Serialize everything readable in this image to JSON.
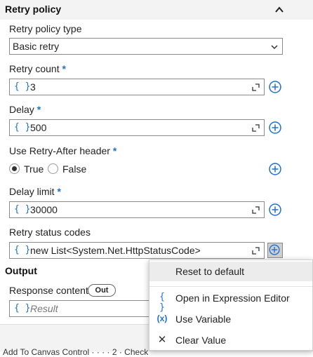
{
  "header": {
    "title": "Retry policy"
  },
  "retry_policy_type": {
    "label": "Retry policy type",
    "value": "Basic retry"
  },
  "retry_count": {
    "label": "Retry count",
    "required": "*",
    "value": "3"
  },
  "delay": {
    "label": "Delay",
    "required": "*",
    "value": "500"
  },
  "retry_after": {
    "label": "Use Retry-After header",
    "required": "*",
    "true_label": "True",
    "false_label": "False",
    "selected": "True"
  },
  "delay_limit": {
    "label": "Delay limit",
    "required": "*",
    "value": "30000"
  },
  "retry_status_codes": {
    "label": "Retry status codes",
    "value": "new List<System.Net.HttpStatusCode>"
  },
  "output": {
    "title": "Output",
    "response_content": {
      "label": "Response content",
      "badge": "Out",
      "placeholder": "Result"
    }
  },
  "footer": {
    "text": "Add To Canvas Control · · · · 2 · Check"
  },
  "context_menu": {
    "items": [
      {
        "label": "Reset to default",
        "icon": ""
      },
      {
        "label": "Open in Expression Editor",
        "icon": "{ }"
      },
      {
        "label": "Use Variable",
        "icon": "(x)"
      },
      {
        "label": "Clear Value",
        "icon": "✕"
      }
    ]
  },
  "field_prefix": "{ }",
  "colors": {
    "accent": "#1f6fd1",
    "header_bg": "#f3f3f3",
    "border": "#8a8a8a"
  }
}
